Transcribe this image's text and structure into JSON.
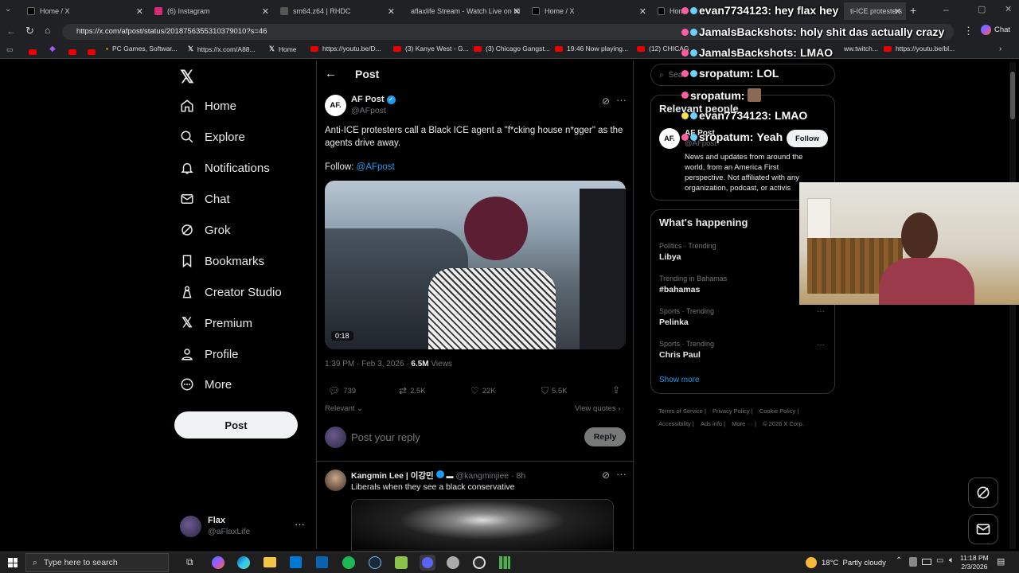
{
  "browser": {
    "tabs": [
      {
        "label": "Home / X",
        "color": "#000"
      },
      {
        "label": "(6) Instagram",
        "color": "#d62976"
      },
      {
        "label": "sm64.z64 | RHDC",
        "color": "#444"
      },
      {
        "label": "aflaxlife Stream - Watch Live on Ki",
        "color": "#53fc18"
      },
      {
        "label": "Home / X",
        "color": "#000"
      },
      {
        "label": "Hom",
        "color": "#000"
      },
      {
        "label": "ti-ICE protesters",
        "color": "#000"
      }
    ],
    "url": "https://x.com/afpost/status/2018756355310379010?s=46",
    "bookmarks": [
      "PC Games, Softwar...",
      "https://x.com/A88...",
      "Home",
      "https://youtu.be/D...",
      "(3) Kanye West - G...",
      "(3) Chicago Gangst...",
      "19:46 Now playing...",
      "(12) CHICAG",
      "ww.twitch...",
      "https://youtu.be/bl..."
    ],
    "chat_label": "Chat"
  },
  "nav": {
    "items": [
      "Home",
      "Explore",
      "Notifications",
      "Chat",
      "Grok",
      "Bookmarks",
      "Creator Studio",
      "Premium",
      "Profile",
      "More"
    ],
    "post_button": "Post",
    "account_name": "Flax",
    "account_handle": "@aFlaxLife"
  },
  "post": {
    "header_title": "Post",
    "author_name": "AF Post",
    "author_handle": "@AFpost",
    "avatar_text": "AF.",
    "text_line1": "Anti-ICE protesters call a Black ICE agent a \"f*cking house n*gger\" as the",
    "text_line2": "agents drive away.",
    "follow_prefix": "Follow:",
    "follow_handle": "@AFpost",
    "video_time": "0:18",
    "timestamp": "1:39 PM · Feb 3, 2026 ·",
    "views_count": "6.5M",
    "views_label": "Views",
    "replies": "739",
    "reposts": "2.5K",
    "likes": "22K",
    "bookmarks": "5.5K",
    "sort_label": "Relevant",
    "view_quotes": "View quotes",
    "reply_placeholder": "Post your reply",
    "reply_button": "Reply"
  },
  "reply": {
    "author": "Kangmin Lee | 이강민",
    "handle": "@kangminjiee · 8h",
    "text": "Liberals when they see a black conservative"
  },
  "right": {
    "search_placeholder": "Sea",
    "relevant_title": "Relevant people",
    "rp_name": "AF Post",
    "rp_handle": "@AFpost",
    "rp_follow": "Follow",
    "rp_bio": [
      "News and updates from around the",
      "world, from an America First",
      "perspective. Not affiliated with any",
      "organization, podcast, or activis"
    ],
    "happening_title": "What's happening",
    "trends": [
      {
        "meta": "Politics · Trending",
        "name": "Libya"
      },
      {
        "meta": "Trending in Bahamas",
        "name": "#bahamas"
      },
      {
        "meta": "Sports · Trending",
        "name": "Pelinka"
      },
      {
        "meta": "Sports · Trending",
        "name": "Chris Paul"
      }
    ],
    "show_more": "Show more",
    "footer1": [
      "Terms of Service",
      "Privacy Policy",
      "Cookie Policy"
    ],
    "footer2": [
      "Accessibility",
      "Ads info",
      "More ···",
      "© 2026 X Corp."
    ]
  },
  "chat_overlay": [
    {
      "user": "evan7734123:",
      "msg": "hey flax hey"
    },
    {
      "user": "JamalsBackshots:",
      "msg": "holy shit das actually crazy"
    },
    {
      "user": "JamalsBackshots:",
      "msg": "LMAO"
    },
    {
      "user": "sropatum:",
      "msg": "LOL"
    },
    {
      "user": "sropatum:",
      "msg": ""
    },
    {
      "user": "evan7734123:",
      "msg": "LMAO"
    },
    {
      "user": "sropatum:",
      "msg": "Yeah"
    }
  ],
  "taskbar": {
    "search_placeholder": "Type here to search",
    "weather": "18°C  Partly cloudy",
    "time": "11:18 PM",
    "date": "2/3/2026"
  }
}
